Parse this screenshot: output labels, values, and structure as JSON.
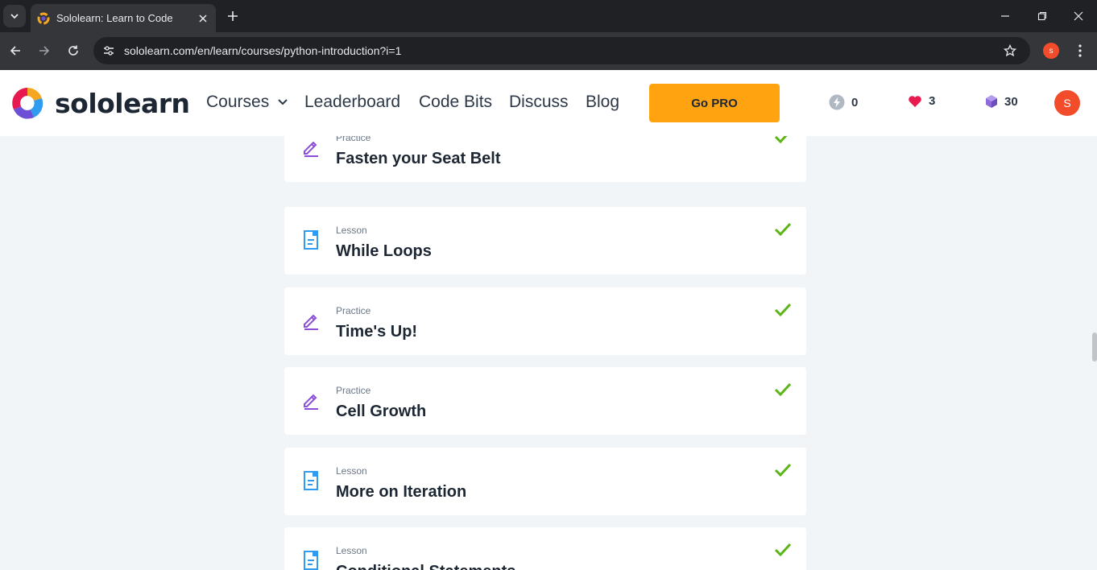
{
  "browser": {
    "tab_title": "Sololearn: Learn to Code",
    "url": "sololearn.com/en/learn/courses/python-introduction?i=1",
    "profile_initial": "s"
  },
  "header": {
    "logo_text": "sololearn",
    "nav": {
      "courses": "Courses",
      "leaderboard": "Leaderboard",
      "code_bits": "Code Bits",
      "discuss": "Discuss",
      "blog": "Blog"
    },
    "go_pro": "Go PRO",
    "stats": {
      "streak": "0",
      "hearts": "3",
      "gems": "30"
    },
    "avatar_initial": "S"
  },
  "items": [
    {
      "type": "Practice",
      "title": "Fasten your Seat Belt",
      "icon": "practice-pencil-icon",
      "completed": true
    },
    {
      "type": "Lesson",
      "title": "While Loops",
      "icon": "lesson-document-icon",
      "completed": true
    },
    {
      "type": "Practice",
      "title": "Time's Up!",
      "icon": "practice-pencil-icon",
      "completed": true
    },
    {
      "type": "Practice",
      "title": "Cell Growth",
      "icon": "practice-pencil-icon",
      "completed": true
    },
    {
      "type": "Lesson",
      "title": "More on Iteration",
      "icon": "lesson-document-icon",
      "completed": true
    },
    {
      "type": "Lesson",
      "title": "Conditional Statements",
      "icon": "lesson-document-icon",
      "completed": true
    }
  ],
  "colors": {
    "accent_orange": "#ffa310",
    "check_green": "#5cb516",
    "practice_purple": "#8a4fd6",
    "lesson_blue": "#2f9cf2",
    "heart_pink": "#e8194e",
    "gem_purple": "#8f6bd9"
  }
}
